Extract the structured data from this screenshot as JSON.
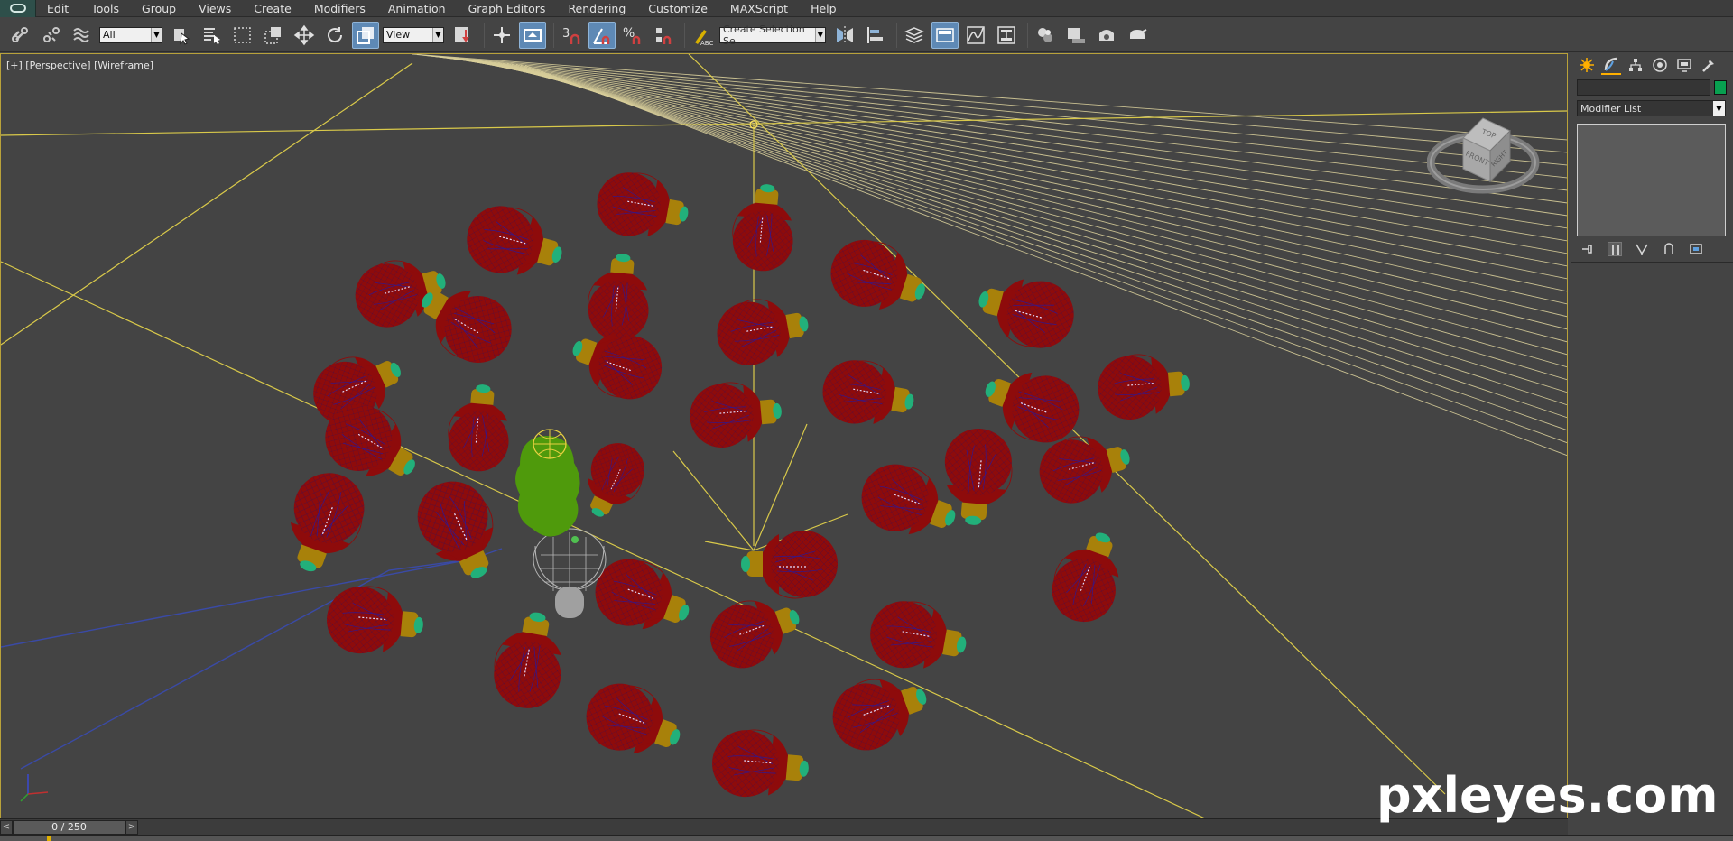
{
  "menu": {
    "items": [
      "Edit",
      "Tools",
      "Group",
      "Views",
      "Create",
      "Modifiers",
      "Animation",
      "Graph Editors",
      "Rendering",
      "Customize",
      "MAXScript",
      "Help"
    ]
  },
  "toolbar": {
    "selection_filter": "All",
    "reference_coord_system": "View",
    "snap_label": "3",
    "named_selection_placeholder": "Create Selection Se"
  },
  "viewport": {
    "label": "[+] [Perspective] [Wireframe]",
    "viewcube_top": "TOP",
    "viewcube_front": "FRONT",
    "viewcube_right": "RIGHT"
  },
  "command_panel": {
    "object_name": "",
    "object_color": "#08a050",
    "modifier_list": "Modifier List"
  },
  "time_slider": {
    "frame_display": "0 / 250",
    "prev": "<",
    "next": ">"
  },
  "watermark": "pxleyes.com",
  "icons": [
    "select-and-link-icon",
    "unlink-icon",
    "bind-space-warp-icon",
    "select-object-icon",
    "select-by-name-icon",
    "rectangular-selection-icon",
    "window-crossing-icon",
    "select-move-icon",
    "select-rotate-icon",
    "select-scale-icon",
    "pivot-icon",
    "manipulate-icon",
    "keyboard-shortcut-icon",
    "snap-toggle-icon",
    "angle-snap-icon",
    "percent-snap-icon",
    "spinner-snap-icon",
    "edit-named-selection-icon",
    "mirror-icon",
    "align-icon",
    "layer-manager-icon",
    "ribbon-icon",
    "curve-editor-icon",
    "schematic-view-icon",
    "material-editor-icon",
    "render-setup-icon",
    "rendered-frame-icon",
    "render-icon"
  ]
}
